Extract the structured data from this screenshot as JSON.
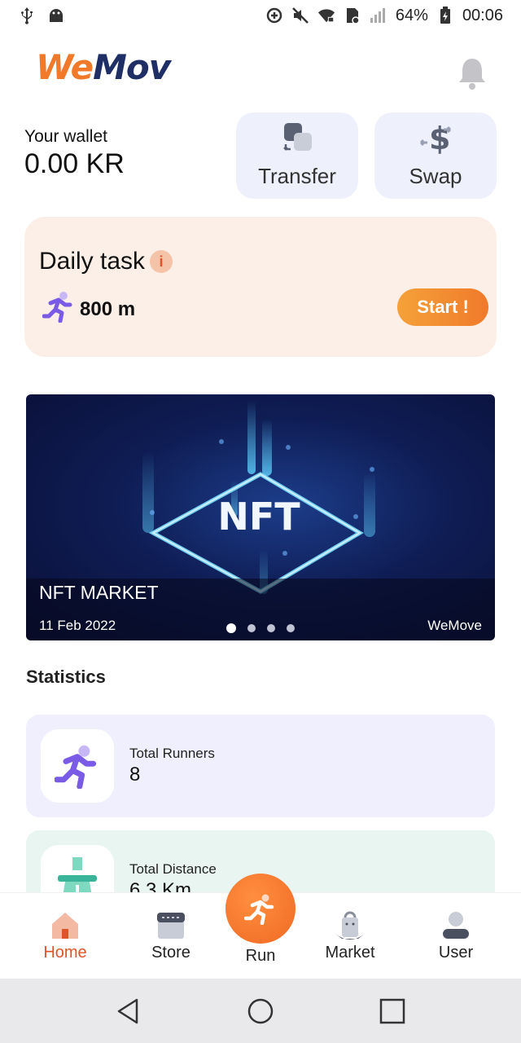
{
  "status_bar": {
    "battery": "64%",
    "time": "00:06",
    "icons": [
      "usb-icon",
      "android-debug-icon",
      "data-saver-icon",
      "mute-icon",
      "wifi-icon",
      "no-sim-icon",
      "signal-icon",
      "battery-charging-icon"
    ]
  },
  "header": {
    "logo_part1": "We",
    "logo_part2": "Mov",
    "bell_icon": "bell-icon"
  },
  "wallet": {
    "label": "Your wallet",
    "value": "0.00 KR"
  },
  "actions": {
    "transfer": "Transfer",
    "swap": "Swap"
  },
  "daily_task": {
    "title": "Daily task",
    "distance": "800 m",
    "start": "Start !"
  },
  "banner": {
    "title": "NFT MARKET",
    "date": "11 Feb 2022",
    "source": "WeMove",
    "image_text": "NFT",
    "slides": 4,
    "active_slide": 1
  },
  "statistics": {
    "title": "Statistics",
    "items": [
      {
        "label": "Total Runners",
        "value": "8"
      },
      {
        "label": "Total Distance",
        "value": "6.3 Km"
      }
    ]
  },
  "bottom_nav": {
    "home": "Home",
    "store": "Store",
    "run": "Run",
    "market": "Market",
    "user": "User",
    "active": "Home"
  },
  "colors": {
    "accent": "#f07a2a",
    "brand_dark": "#1f2f66",
    "daily_bg": "#fbefe7",
    "runners_bg": "#f0effd",
    "distance_bg": "#e8f5f1"
  }
}
